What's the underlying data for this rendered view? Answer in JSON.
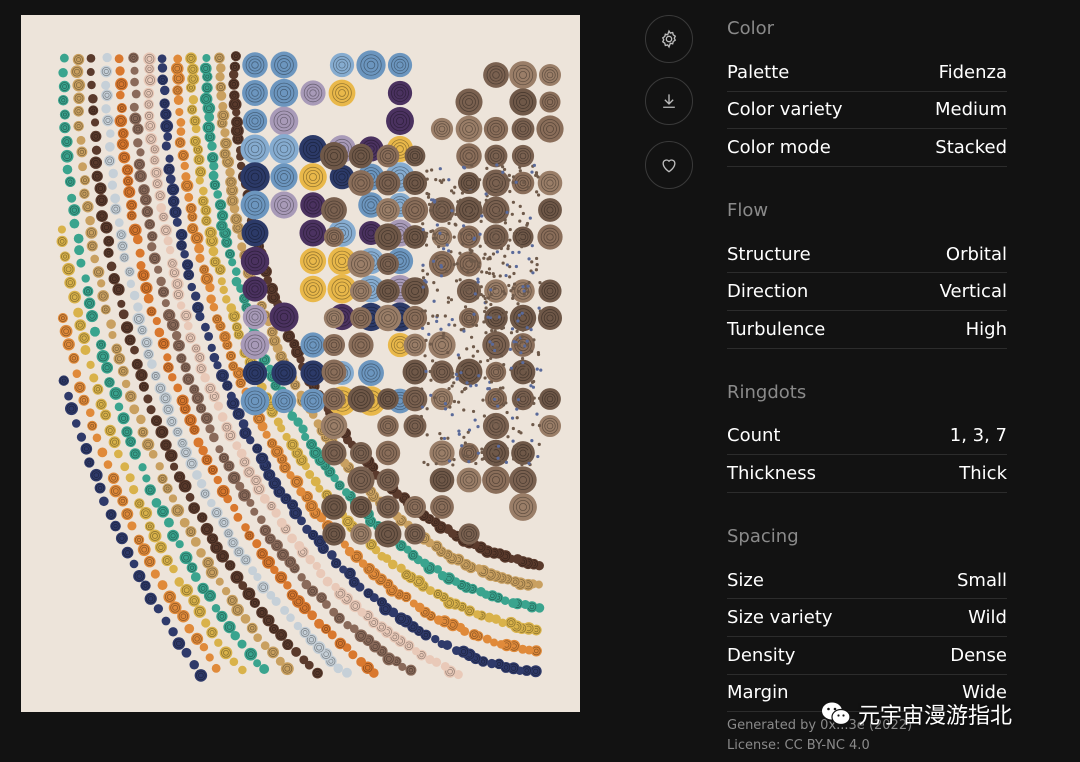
{
  "actions": {
    "settings_icon": "gear-icon",
    "download_icon": "download-icon",
    "favorite_icon": "heart-icon"
  },
  "sections": [
    {
      "title": "Color",
      "rows": [
        {
          "label": "Palette",
          "value": "Fidenza"
        },
        {
          "label": "Color variety",
          "value": "Medium"
        },
        {
          "label": "Color mode",
          "value": "Stacked"
        }
      ]
    },
    {
      "title": "Flow",
      "rows": [
        {
          "label": "Structure",
          "value": "Orbital"
        },
        {
          "label": "Direction",
          "value": "Vertical"
        },
        {
          "label": "Turbulence",
          "value": "High"
        }
      ]
    },
    {
      "title": "Ringdots",
      "rows": [
        {
          "label": "Count",
          "value": "1, 3, 7"
        },
        {
          "label": "Thickness",
          "value": "Thick"
        }
      ]
    },
    {
      "title": "Spacing",
      "rows": [
        {
          "label": "Size",
          "value": "Small"
        },
        {
          "label": "Size variety",
          "value": "Wild"
        },
        {
          "label": "Density",
          "value": "Dense"
        },
        {
          "label": "Margin",
          "value": "Wide"
        }
      ]
    }
  ],
  "meta": {
    "generated_by": "Generated by 0x...3e (2022)",
    "license": "License: CC BY-NC 4.0"
  },
  "watermark": {
    "text": "元宇宙漫游指北"
  },
  "colors": {
    "background": "#121212",
    "canvas": "#ede4da",
    "section_title": "#8a8a8a",
    "row_border": "#2c2c2c"
  }
}
